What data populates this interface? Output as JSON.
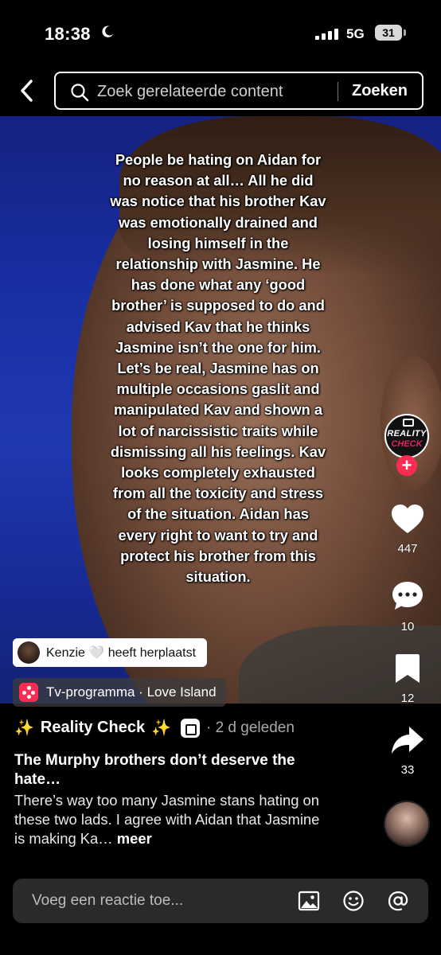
{
  "status_bar": {
    "time": "18:38",
    "network": "5G",
    "battery": "31"
  },
  "search": {
    "placeholder": "Zoek gerelateerde content",
    "button_label": "Zoeken"
  },
  "video": {
    "overlay_text": "People be hating on Aidan for no reason at all… All he did was notice that his brother Kav was emotionally drained and losing himself in the relationship with Jasmine. He has done what any ‘good brother’ is supposed to do and advised Kav that he thinks Jasmine isn’t the one for him. Let’s be real, Jasmine has on multiple occasions gaslit and manipulated Kav and shown a lot of narcissistic traits while dismissing all his feelings. Kav looks completely exhausted from all the toxicity and stress of the situation. Aidan has every right to want to try and protect his brother from this situation."
  },
  "creator_avatar": {
    "line1": "REALITY",
    "line2": "CHECK"
  },
  "actions": {
    "likes": "447",
    "comments": "10",
    "saves": "12",
    "shares": "33"
  },
  "repost": {
    "text": "Kenzie 🤍 heeft herplaatst"
  },
  "program": {
    "label": "Tv-programma · Love Island"
  },
  "post": {
    "author": "Reality Check",
    "sparkle_left": "✨",
    "sparkle_right": "✨",
    "date": "· 2 d geleden",
    "title": "The Murphy brothers don’t deserve the hate…",
    "description": "There’s way too many Jasmine stans hating on these two lads. I agree with Aidan that Jasmine is making Ka…",
    "more": "meer"
  },
  "comment_bar": {
    "placeholder": "Voeg een reactie toe..."
  },
  "colors": {
    "accent": "#fe2c55",
    "background": "#000000",
    "comment_bar": "#2a2a2a"
  },
  "icons": [
    "back-chevron-icon",
    "search-icon",
    "heart-icon",
    "comment-icon",
    "bookmark-icon",
    "share-icon",
    "image-icon",
    "emoji-icon",
    "mention-icon",
    "moon-icon"
  ]
}
